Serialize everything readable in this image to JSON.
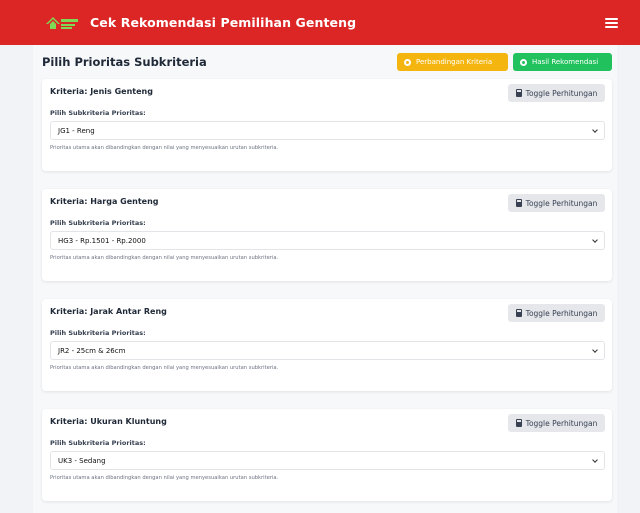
{
  "navbar": {
    "brand": "Cek Rekomendasi Pemilihan Genteng",
    "logo_icon": "house-roof-logo-icon",
    "menu_icon": "hamburger-menu-icon"
  },
  "colors": {
    "primary": "#dc2626",
    "warning": "#f5b50f",
    "success": "#21c25e"
  },
  "page": {
    "title": "Pilih Prioritas Subkriteria",
    "btn_perbandingan": "Perbandingan Kriteria",
    "btn_hasil": "Hasil Rekomendasi"
  },
  "cards": [
    {
      "title": "Kriteria: Jenis Genteng",
      "toggle": "Toggle Perhitungan",
      "label": "Pilih Subkriteria Prioritas:",
      "selected": "JG1 - Reng",
      "help": "Prioritas utama akan dibandingkan dengan nilai yang menyesuaikan urutan subkriteria."
    },
    {
      "title": "Kriteria: Harga Genteng",
      "toggle": "Toggle Perhitungan",
      "label": "Pilih Subkriteria Prioritas:",
      "selected": "HG3 - Rp.1501 - Rp.2000",
      "help": "Prioritas utama akan dibandingkan dengan nilai yang menyesuaikan urutan subkriteria."
    },
    {
      "title": "Kriteria: Jarak Antar Reng",
      "toggle": "Toggle Perhitungan",
      "label": "Pilih Subkriteria Prioritas:",
      "selected": "JR2 - 25cm & 26cm",
      "help": "Prioritas utama akan dibandingkan dengan nilai yang menyesuaikan urutan subkriteria."
    },
    {
      "title": "Kriteria: Ukuran Kluntung",
      "toggle": "Toggle Perhitungan",
      "label": "Pilih Subkriteria Prioritas:",
      "selected": "UK3 - Sedang",
      "help": "Prioritas utama akan dibandingkan dengan nilai yang menyesuaikan urutan subkriteria."
    }
  ]
}
